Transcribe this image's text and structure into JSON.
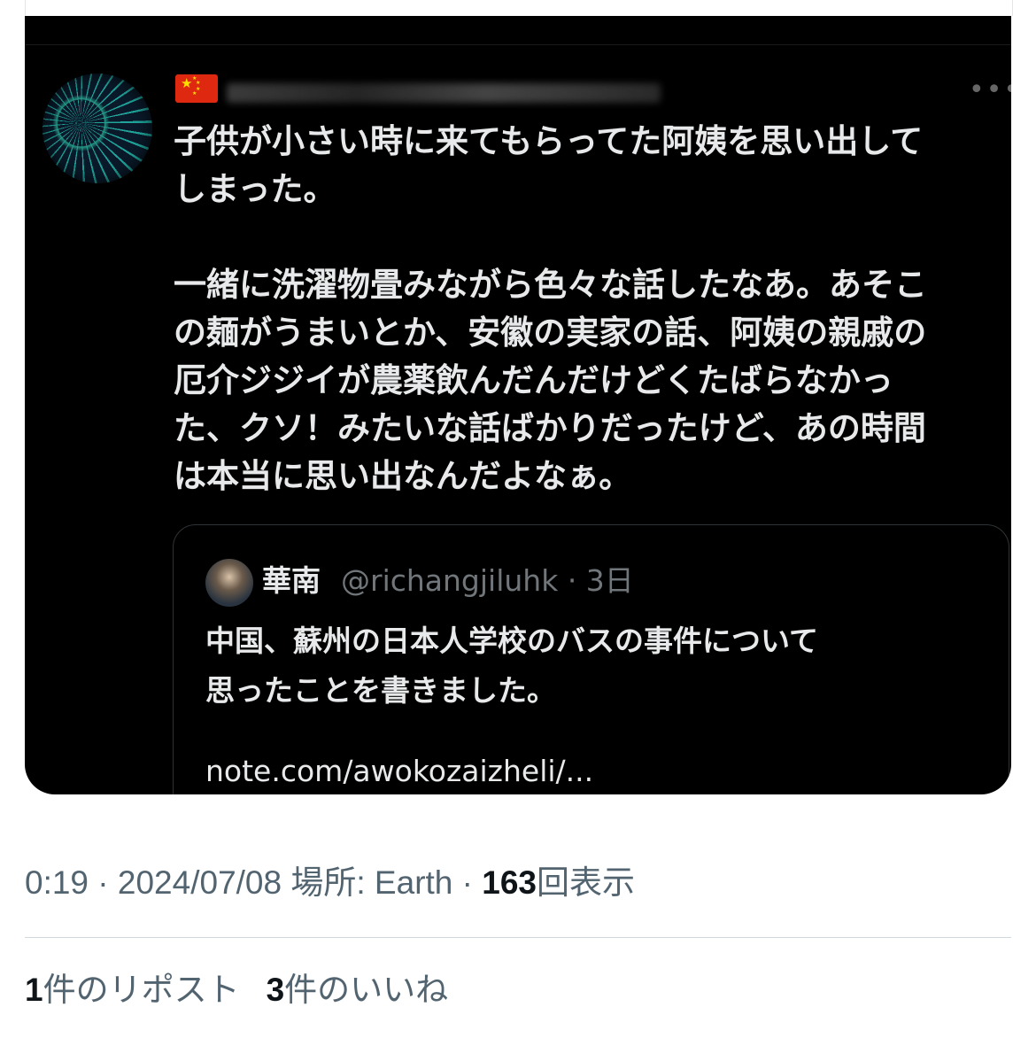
{
  "post": {
    "text": "子供が小さい時に来てもらってた阿姨を思い出して\nしまった。\n\n一緒に洗濯物畳みながら色々な話したなあ。あそこ\nの麺がうまいとか、安徽の実家の話、阿姨の親戚の\n厄介ジジイが農薬飲んだんだけどくたばらなかっ\nた、クソ！みたいな話ばかりだったけど、あの時間\nは本当に思い出なんだよなぁ。",
    "more_icon": "•••"
  },
  "quote": {
    "name": "華南",
    "handle": "@richangjiluhk · 3日",
    "text": "中国、蘇州の日本人学校のバスの事件について\n思ったことを書きました。",
    "link": "note.com/awokozaizheli/..."
  },
  "meta": {
    "time": "0:19",
    "sep1": " · ",
    "date": "2024/07/08",
    "location": " 場所: Earth",
    "sep2": " · ",
    "views_count": "163",
    "views_label": "回表示"
  },
  "stats": {
    "reposts_count": "1",
    "reposts_label": "件のリポスト",
    "likes_count": "3",
    "likes_label": "件のいいね"
  },
  "colors": {
    "card_bg": "#000000",
    "text_dark_mode": "#e7e9ea",
    "secondary": "#536471",
    "flag_red": "#de2910",
    "flag_yellow": "#ffde00"
  }
}
